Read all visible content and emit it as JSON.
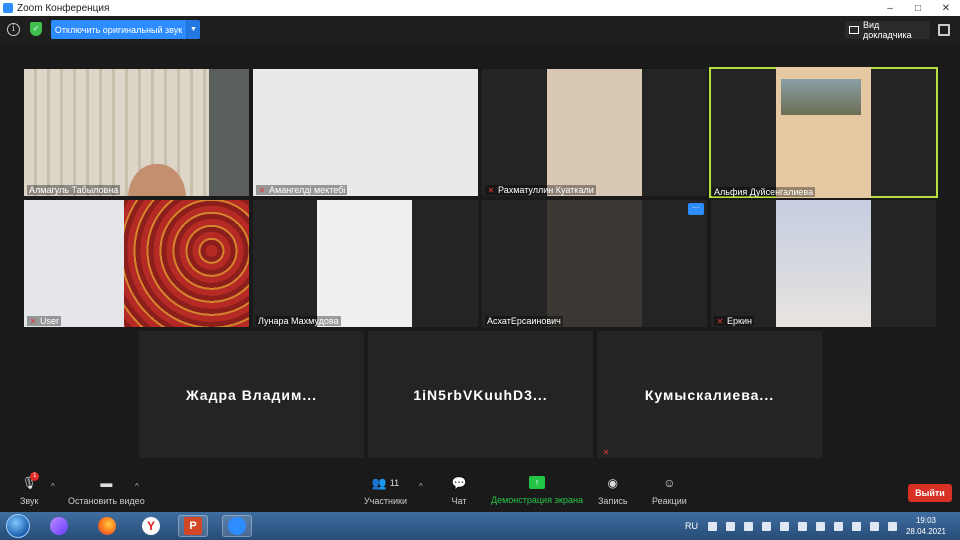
{
  "window": {
    "title": "Zoom Конференция",
    "controls": [
      "–",
      "□",
      "✕"
    ]
  },
  "topbar": {
    "original_sound_button": "Отключить оригинальный звук",
    "speaker_view_button": "Вид докладчика"
  },
  "participants": [
    {
      "name": "Алмагуль Табыловна",
      "muted": false
    },
    {
      "name": "Амангелді мектебі",
      "muted": true
    },
    {
      "name": "Рахматуллин Куаткали",
      "muted": true
    },
    {
      "name": "Альфия Дуйсенгалиева",
      "muted": false,
      "active_speaker": true
    },
    {
      "name": "User",
      "muted": true
    },
    {
      "name": "Лунара Махмудова",
      "muted": false
    },
    {
      "name": "АсхатЕрсаинович",
      "muted": false
    },
    {
      "name": "Еркин",
      "muted": true
    },
    {
      "name": "Жадра Владим...",
      "muted": false,
      "video_off": true
    },
    {
      "name": "1iN5rbVKuuhD3...",
      "muted": false,
      "video_off": true
    },
    {
      "name": "Кумыскалиева...",
      "muted": true,
      "video_off": true
    }
  ],
  "more_button": "···",
  "toolbar": {
    "audio_label": "Звук",
    "audio_badge": "1",
    "video_label": "Остановить видео",
    "participants_label": "Участники",
    "participants_count": "11",
    "chat_label": "Чат",
    "share_label": "Демонстрация экрана",
    "record_label": "Запись",
    "reactions_label": "Реакции",
    "leave_label": "Выйти"
  },
  "taskbar": {
    "language": "RU",
    "time": "19:03",
    "date": "28.04.2021",
    "yandex_letter": "Y",
    "ppt_letter": "P"
  },
  "colors": {
    "zoom_blue": "#2d8cff",
    "active_border": "#b9df3f",
    "share_green": "#23c447",
    "leave_red": "#d93025"
  }
}
